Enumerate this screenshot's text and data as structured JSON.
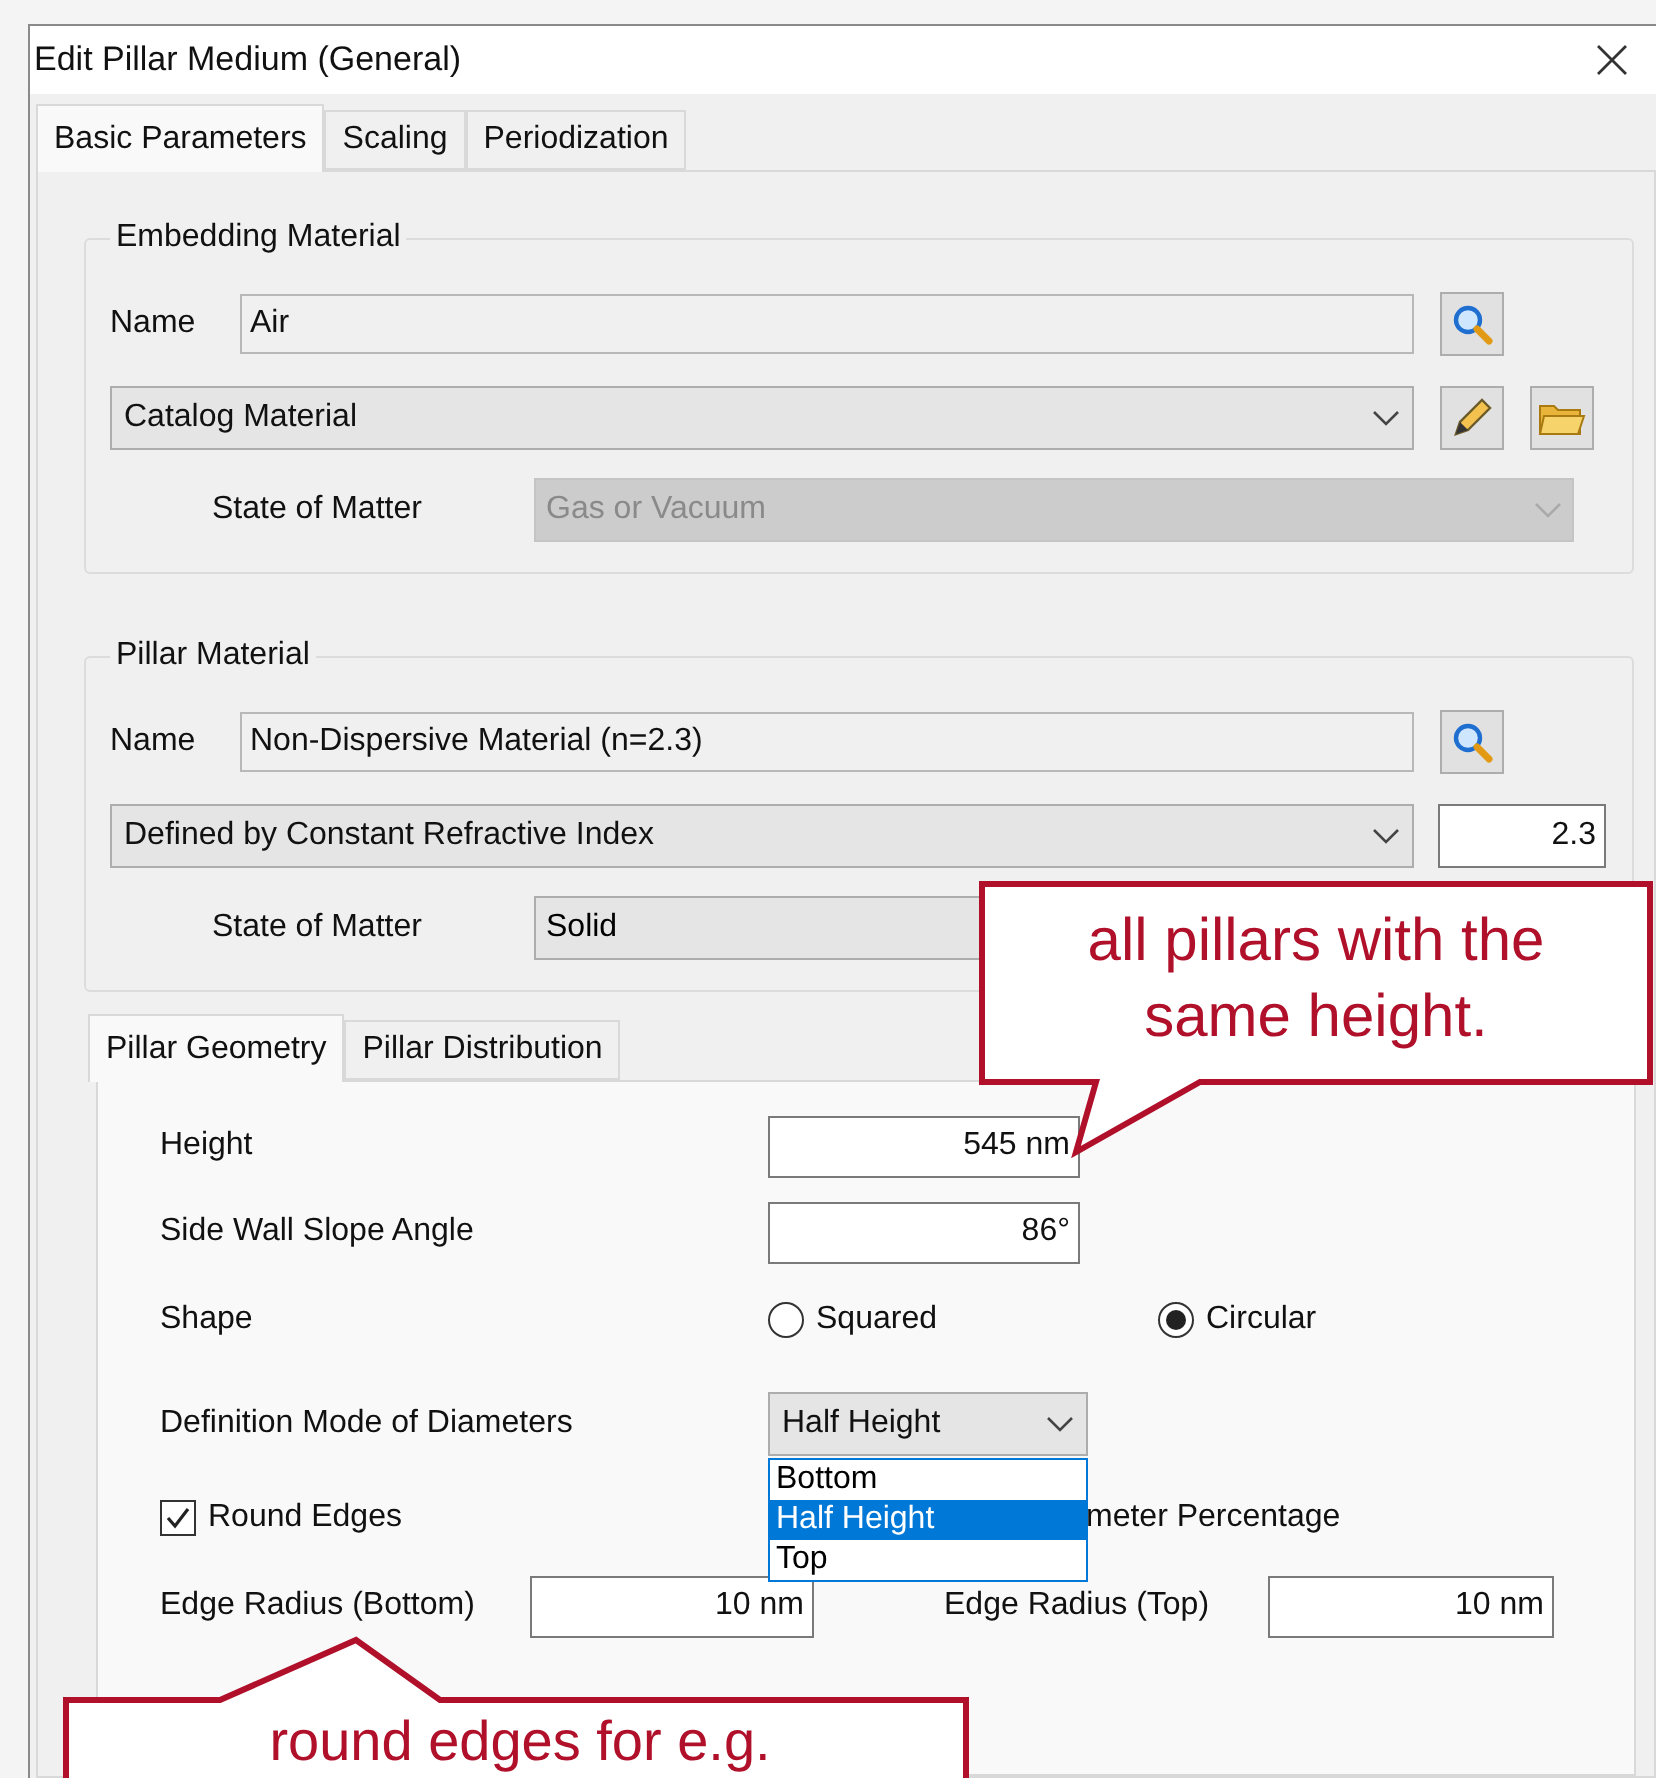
{
  "window": {
    "title": "Edit Pillar Medium (General)"
  },
  "tabs": [
    {
      "label": "Basic Parameters",
      "selected": true
    },
    {
      "label": "Scaling",
      "selected": false
    },
    {
      "label": "Periodization",
      "selected": false
    }
  ],
  "embedding_material": {
    "title": "Embedding Material",
    "name_label": "Name",
    "name_value": "Air",
    "type": "Catalog Material",
    "state_label": "State of Matter",
    "state_value": "Gas or Vacuum",
    "state_disabled": true
  },
  "pillar_material": {
    "title": "Pillar Material",
    "name_label": "Name",
    "name_value": "Non-Dispersive Material (n=2.3)",
    "type": "Defined by Constant Refractive Index",
    "refractive_index": "2.3",
    "state_label": "State of Matter",
    "state_value": "Solid",
    "state_disabled": false
  },
  "geometry_tabs": [
    {
      "label": "Pillar Geometry",
      "selected": true
    },
    {
      "label": "Pillar Distribution",
      "selected": false
    }
  ],
  "geometry": {
    "height_label": "Height",
    "height_value": "545 nm",
    "slope_label": "Side Wall Slope Angle",
    "slope_value": "86°",
    "shape_label": "Shape",
    "shape_options": [
      {
        "label": "Squared",
        "selected": false
      },
      {
        "label": "Circular",
        "selected": true
      }
    ],
    "diameter_mode_label": "Definition Mode of Diameters",
    "diameter_mode_value": "Half Height",
    "diameter_mode_options": [
      {
        "label": "Bottom",
        "selected": false
      },
      {
        "label": "Half Height",
        "selected": true
      },
      {
        "label": "Top",
        "selected": false
      }
    ],
    "round_edges": {
      "label": "Round Edges",
      "checked": true
    },
    "partial_label": "meter Percentage",
    "edge_radius_bottom_label": "Edge Radius (Bottom)",
    "edge_radius_bottom_value": "10 nm",
    "edge_radius_top_label": "Edge Radius (Top)",
    "edge_radius_top_value": "10 nm"
  },
  "callouts": [
    {
      "text": "all pillars with the same height."
    },
    {
      "text": "round edges for e.g."
    }
  ]
}
